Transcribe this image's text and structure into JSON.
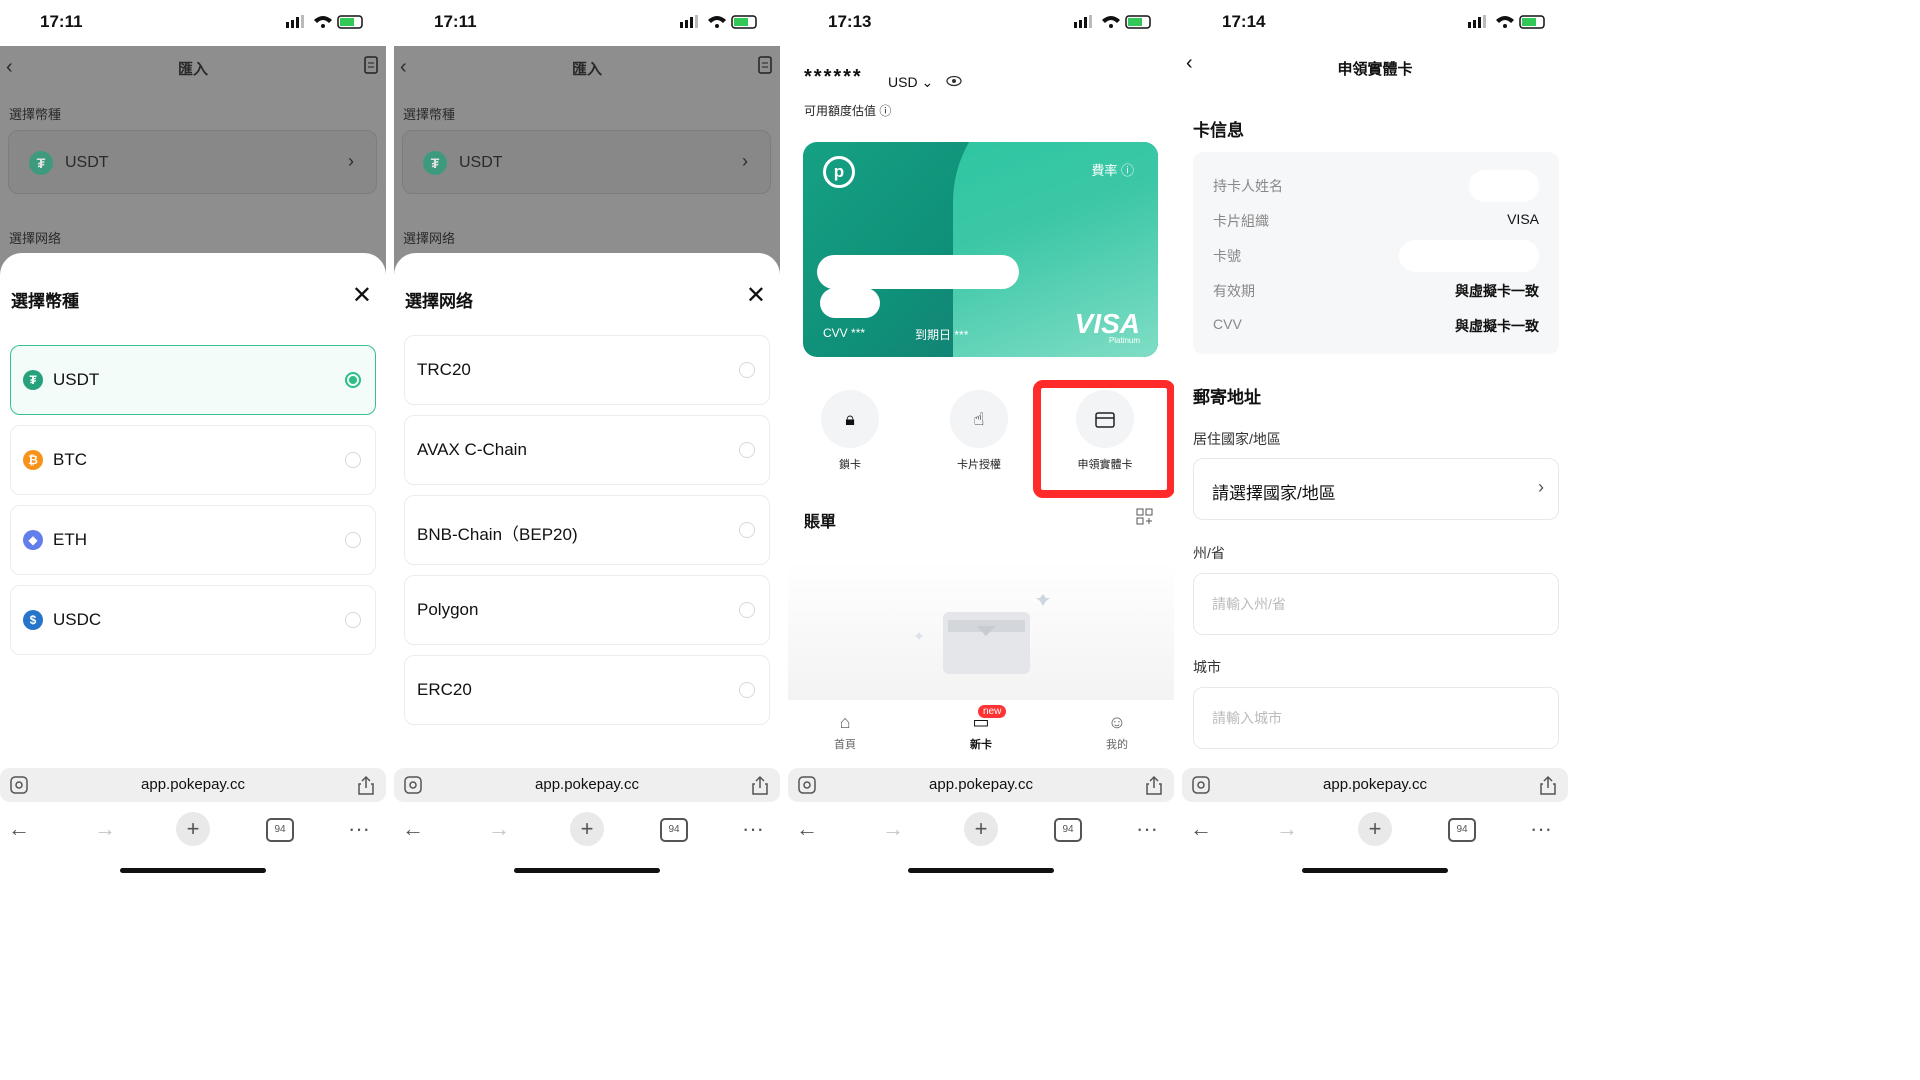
{
  "status_times": [
    "17:11",
    "17:11",
    "17:13",
    "17:14"
  ],
  "browser": {
    "url": "app.pokepay.cc",
    "tabs_count": "94"
  },
  "import_page": {
    "title": "匯入",
    "select_coin_label": "選擇幣種",
    "selected_coin": "USDT",
    "select_network_label": "選擇网络"
  },
  "coin_sheet": {
    "title": "選擇幣種",
    "options": [
      {
        "label": "USDT",
        "color": "#26A17B",
        "glyph": "₮",
        "selected": true
      },
      {
        "label": "BTC",
        "color": "#F7931A",
        "glyph": "₿",
        "selected": false
      },
      {
        "label": "ETH",
        "color": "#627EEA",
        "glyph": "◆",
        "selected": false
      },
      {
        "label": "USDC",
        "color": "#2775CA",
        "glyph": "$",
        "selected": false
      }
    ]
  },
  "network_sheet": {
    "title": "選擇网络",
    "options": [
      "TRC20",
      "AVAX C-Chain",
      "BNB-Chain（BEP20)",
      "Polygon",
      "ERC20"
    ]
  },
  "card_page": {
    "balance_masked": "******",
    "currency": "USD",
    "available_label": "可用額度估值",
    "card": {
      "rate_label": "費率",
      "cvv_label": "CVV",
      "cvv_mask": "***",
      "expiry_label": "到期日",
      "expiry_mask": "***",
      "brand": "VISA",
      "tier": "Platinum"
    },
    "actions": [
      "鎖卡",
      "卡片授權",
      "申領實體卡"
    ],
    "bill_title": "賬單",
    "tabs": [
      {
        "label": "首頁",
        "icon": "home-icon"
      },
      {
        "label": "新卡",
        "icon": "card-icon"
      },
      {
        "label": "我的",
        "icon": "user-icon"
      }
    ],
    "new_badge": "new"
  },
  "apply_page": {
    "title": "申領實體卡",
    "card_info_title": "卡信息",
    "card_info_rows": [
      {
        "key": "持卡人姓名",
        "value": ""
      },
      {
        "key": "卡片組織",
        "value": "VISA"
      },
      {
        "key": "卡號",
        "value": ""
      },
      {
        "key": "有效期",
        "value": "與虛擬卡一致"
      },
      {
        "key": "CVV",
        "value": "與虛擬卡一致"
      }
    ],
    "address_title": "郵寄地址",
    "country_label": "居住國家/地區",
    "country_value": "請選擇國家/地區",
    "state_label": "州/省",
    "state_placeholder": "請輸入州/省",
    "city_label": "城市",
    "city_placeholder": "請輸入城市"
  },
  "colors": {
    "accent": "#2ebd85",
    "highlight": "#ff2a2a",
    "card_start": "#15a184"
  }
}
